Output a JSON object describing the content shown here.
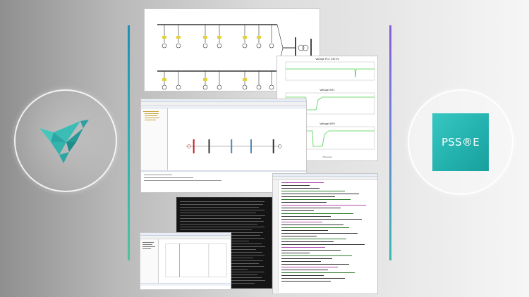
{
  "brand": {
    "product_name": "PSS®E",
    "box_color": "#22b0ad",
    "left_logo": "origami-bird-icon",
    "left_logo_color": "#2fb9b2"
  },
  "accent_lines": {
    "left": "#29b2b0",
    "right": "#8a5ed8"
  },
  "panels": {
    "plot_window": {
      "plots": [
        "Voltage PCC 230 kV",
        "Voltage WT1",
        "Voltage WT9"
      ],
      "xlabel": "Time (sec)"
    }
  }
}
